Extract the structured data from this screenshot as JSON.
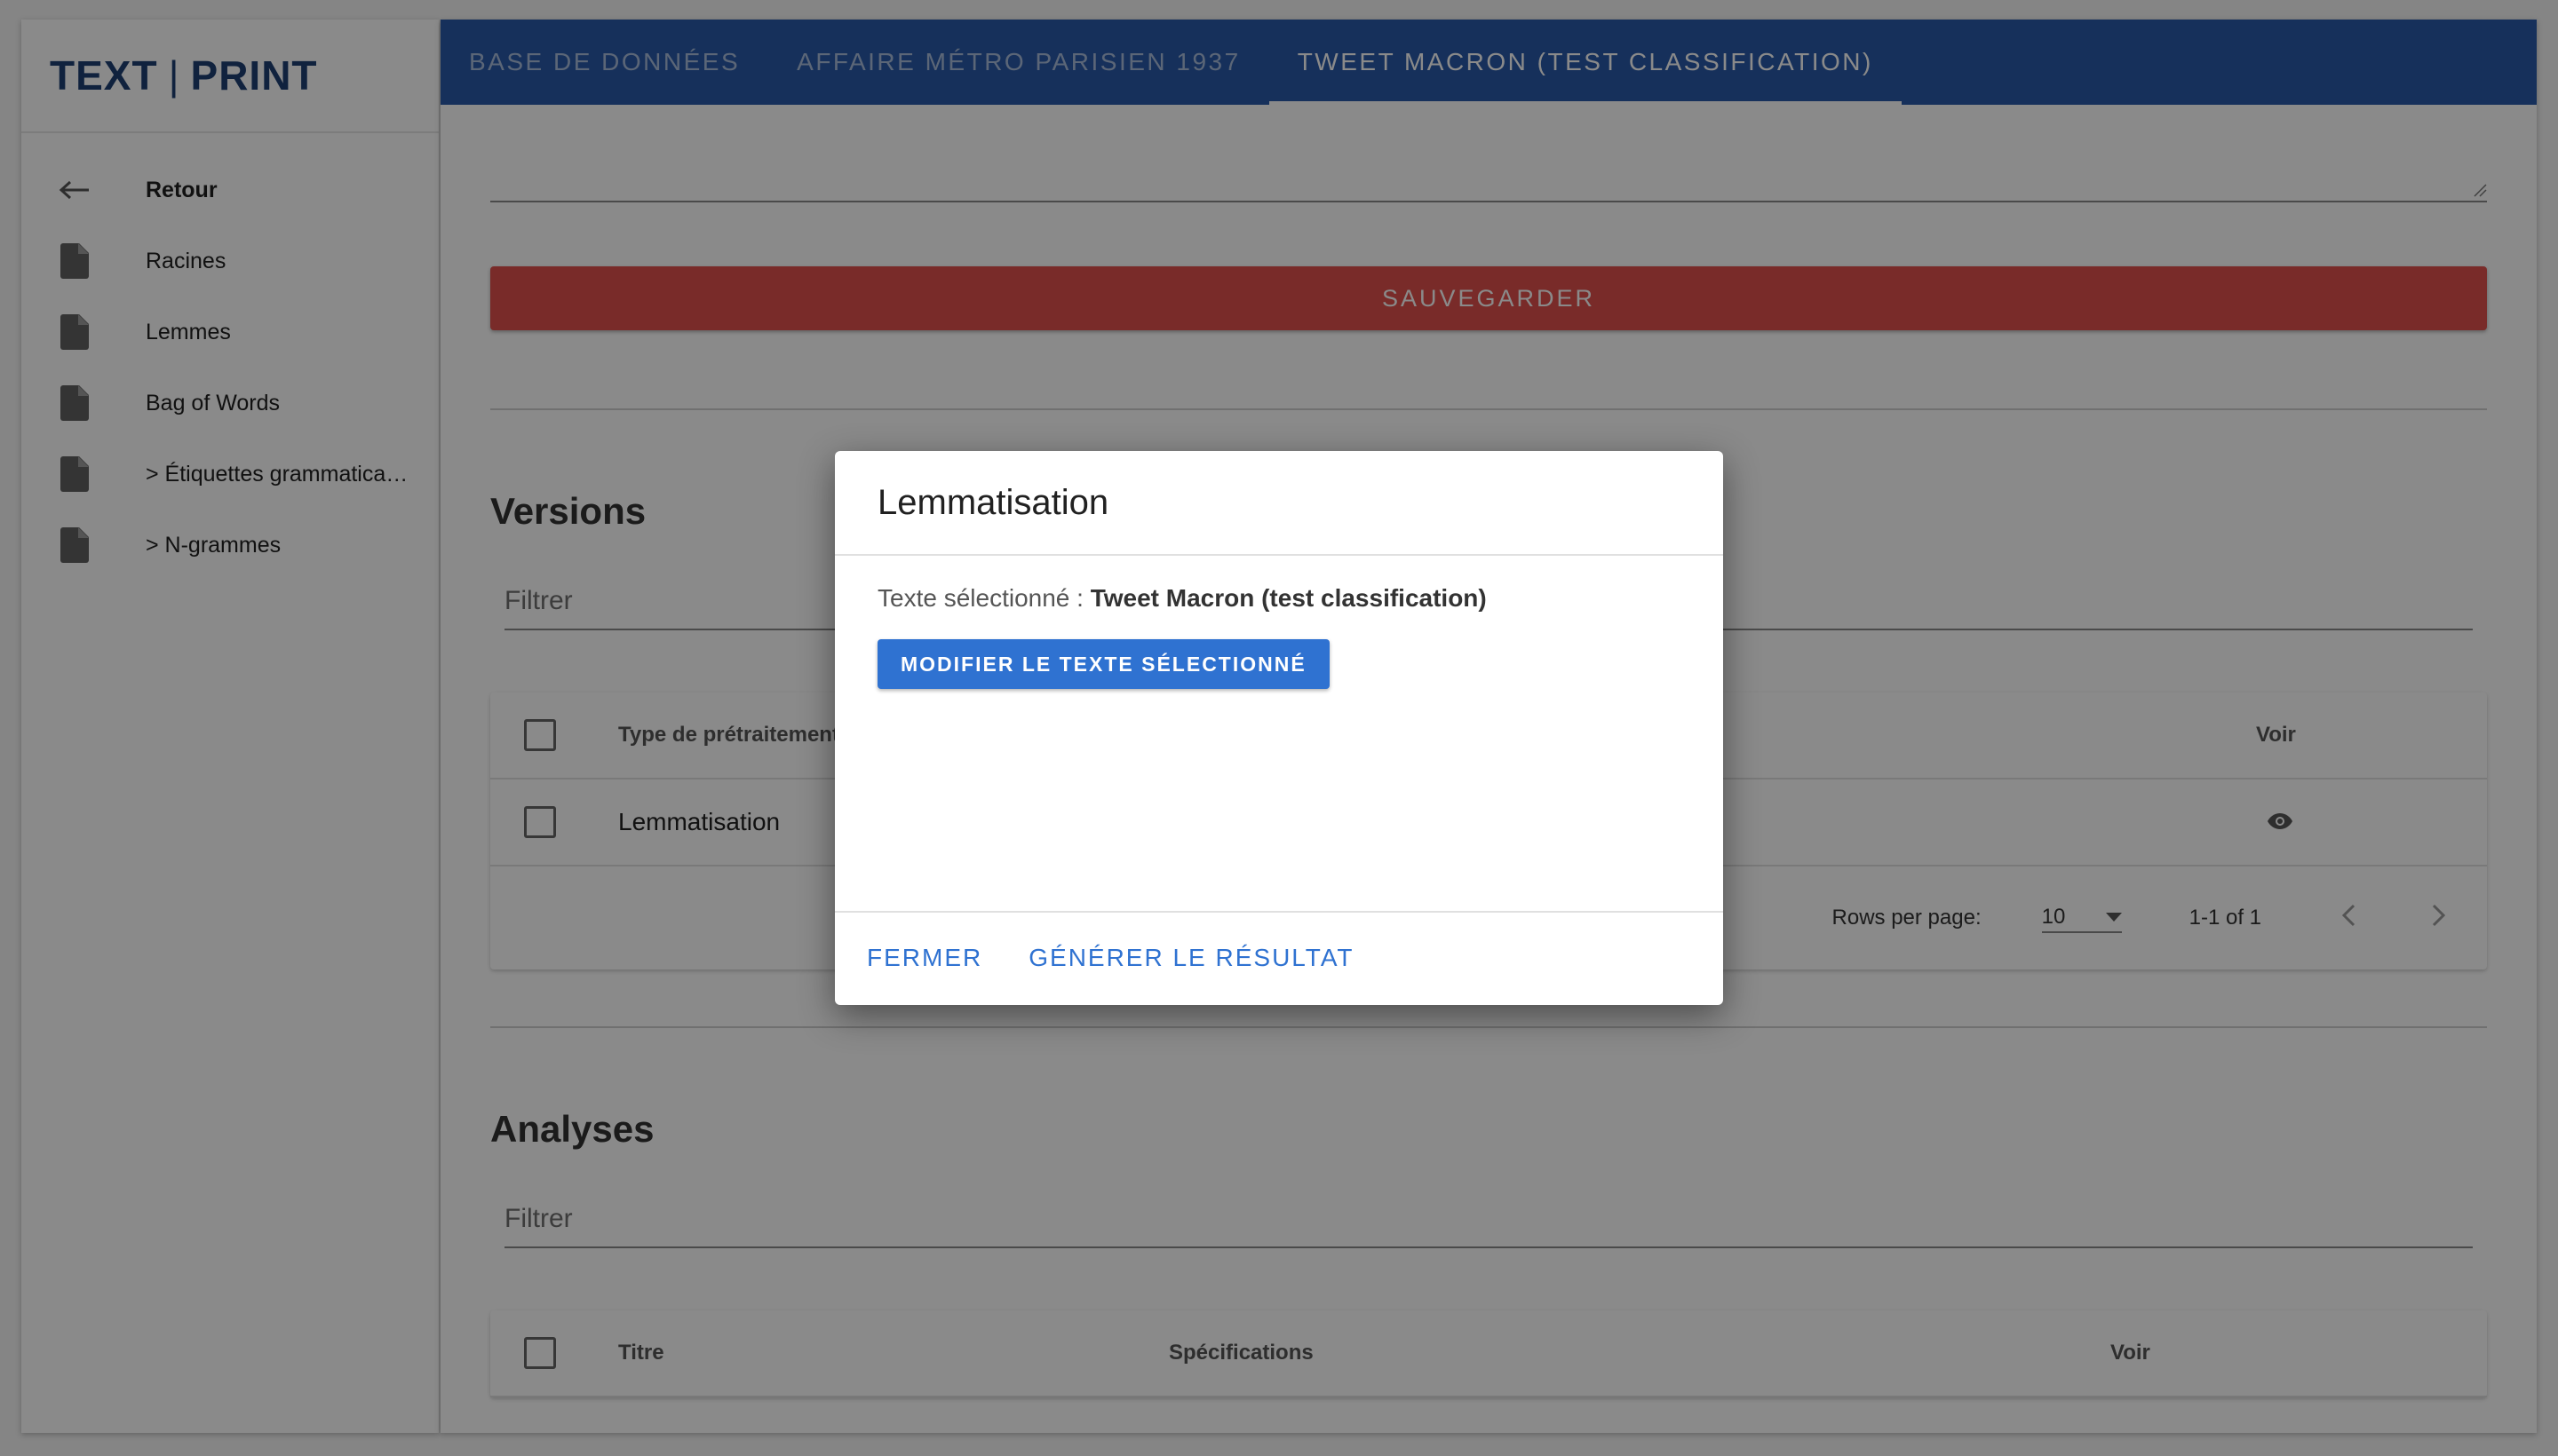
{
  "app": {
    "logo_left": "TEXT",
    "logo_sep": "|",
    "logo_right": "PRINT"
  },
  "sidebar": {
    "items": [
      {
        "label": "Retour",
        "icon": "arrow-left-icon"
      },
      {
        "label": "Racines",
        "icon": "file-icon"
      },
      {
        "label": "Lemmes",
        "icon": "file-icon"
      },
      {
        "label": "Bag of Words",
        "icon": "file-icon"
      },
      {
        "label": "> Étiquettes grammaticales",
        "icon": "file-icon"
      },
      {
        "label": "> N-grammes",
        "icon": "file-icon"
      }
    ]
  },
  "tabs": [
    {
      "label": "Base de données"
    },
    {
      "label": "Affaire Métro Parisien 1937"
    },
    {
      "label": "Tweet Macron (test classification)"
    }
  ],
  "main": {
    "save_label": "SAUVEGARDER",
    "versions": {
      "title": "Versions",
      "filter_placeholder": "Filtrer",
      "headers": {
        "type": "Type de prétraitement",
        "view": "Voir"
      },
      "rows": [
        {
          "type": "Lemmatisation"
        }
      ],
      "footer": {
        "rows_per_page_label": "Rows per page:",
        "rows_per_page_value": "10",
        "range": "1-1 of 1"
      }
    },
    "analyses": {
      "title": "Analyses",
      "filter_placeholder": "Filtrer",
      "headers": {
        "title": "Titre",
        "specs": "Spécifications",
        "view": "Voir"
      }
    }
  },
  "dialog": {
    "title": "Lemmatisation",
    "selected_label": "Texte sélectionné : ",
    "selected_value": "Tweet Macron (test classification)",
    "modify_button": "MODIFIER LE TEXTE SÉLECTIONNÉ",
    "close_button": "FERMER",
    "generate_button": "GÉNÉRER LE RÉSULTAT"
  },
  "colors": {
    "brand": "#1e3f74",
    "tabbar": "#2a5aa8",
    "save": "#e0514c",
    "primary": "#2f72d1"
  }
}
